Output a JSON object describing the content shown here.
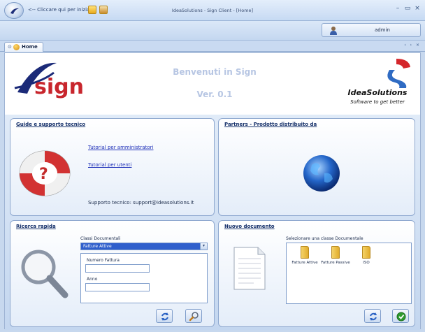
{
  "window": {
    "title": "IdeaSolutions - Sign Client - [Home]",
    "qat_hint": "<-- Cliccare qui per iniziare"
  },
  "ribbon": {
    "user_name": "admin"
  },
  "tabs": [
    {
      "label": "Home",
      "close": "⊙"
    }
  ],
  "tab_nav": "‹ › ×",
  "header": {
    "welcome": "Benvenuti in Sign",
    "version": "Ver. 0.1",
    "company_name": "IdeaSolutions",
    "company_tagline": "Software to get better"
  },
  "guide": {
    "title": "Guide e supporto tecnico",
    "link_admin": "Tutorial per amministratori",
    "link_users": "Tutorial per utenti",
    "support": "Supporto tecnico: support@ideasolutions.it"
  },
  "partners": {
    "title": "Partners - Prodotto distribuito da"
  },
  "search": {
    "title": "Ricerca rapida",
    "classes_label": "Classi Documentali",
    "selected_class": "Fatture Attive",
    "field_invoice_label": "Numero Fattura",
    "field_invoice_value": "",
    "field_year_label": "Anno",
    "field_year_value": ""
  },
  "new_document": {
    "title": "Nuovo documento",
    "prompt": "Selezionare una classe Documentale",
    "classes": [
      "Fatture Attive",
      "Fatture Passive",
      "ISO"
    ]
  },
  "colors": {
    "link": "#1d2fb8",
    "panel_title": "#15306a",
    "selection": "#2f5fcc",
    "header_text": "#b7c6e3"
  }
}
